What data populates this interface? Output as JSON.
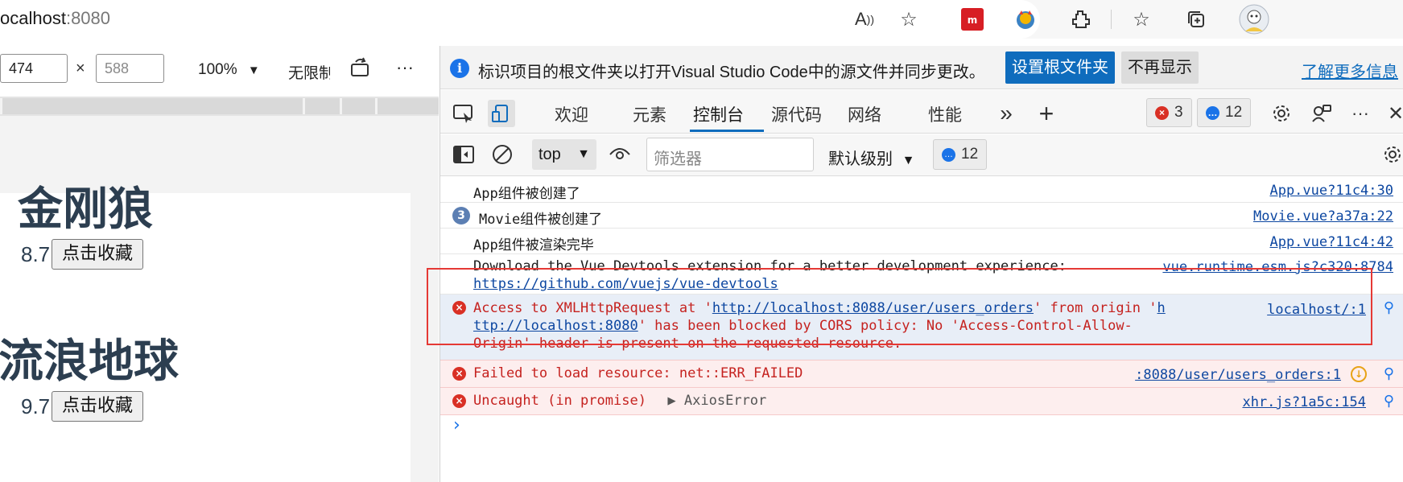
{
  "browser": {
    "url_host": "ocalhost",
    "url_port": ":8080",
    "icons": [
      "read-aloud-icon",
      "add-favorite-icon",
      "mendeley-icon",
      "extension-cat-icon",
      "extensions-icon",
      "favorites-icon",
      "collections-icon",
      "profile-avatar"
    ]
  },
  "device": {
    "width": "474",
    "height_placeholder": "588",
    "times": "×",
    "zoom": "100%",
    "throttle": "无限制",
    "more": "···"
  },
  "page": {
    "movies": [
      {
        "title": "金刚狼",
        "score": "8.7",
        "button": "点击收藏"
      },
      {
        "title": "流浪地球",
        "score": "9.7",
        "button": "点击收藏"
      }
    ]
  },
  "devtools": {
    "info": {
      "text": "标识项目的根文件夹以打开Visual Studio Code中的源文件并同步更改。",
      "primary_button": "设置根文件夹",
      "secondary_button": "不再显示",
      "learn_more": "了解更多信息"
    },
    "tabs": [
      "欢迎",
      "元素",
      "控制台",
      "源代码",
      "网络",
      "性能"
    ],
    "active_tab": "控制台",
    "error_count": "3",
    "message_count": "12",
    "console_bar": {
      "context": "top",
      "filter_placeholder": "筛选器",
      "level": "默认级别",
      "messages": "12"
    },
    "messages": [
      {
        "text": "App组件被创建了",
        "source": "App.vue?11c4:30"
      },
      {
        "count": "3",
        "text": "Movie组件被创建了",
        "source": "Movie.vue?a37a:22"
      },
      {
        "text": "App组件被渲染完毕",
        "source": "App.vue?11c4:42"
      },
      {
        "text": "Download the Vue Devtools extension for a better development experience: ",
        "source": "vue.runtime.esm.js?c320:8784",
        "link": "https://github.com/vuejs/vue-devtools"
      },
      {
        "pre": "Access to XMLHttpRequest at '",
        "url1": "http://localhost:8088/user/users_orders",
        "mid": "' from origin '",
        "url2a": "h",
        "url2b": "ttp://localhost:8080",
        "post1": "' has been blocked by CORS policy: No 'Access-Control-Allow-",
        "post2": "Origin' header is present on the requested resource.",
        "source": "localhost/:1"
      },
      {
        "text": "Failed to load resource: net::ERR_FAILED",
        "source": ":8088/user/users_orders:1"
      },
      {
        "text": "Uncaught (in promise)",
        "object": "AxiosError",
        "source": "xhr.js?1a5c:154"
      }
    ],
    "prompt": "›"
  },
  "colors": {
    "accent": "#0f6cbd",
    "error": "#d93025",
    "error_bg": "#fdeeee",
    "highlight": "#e53935",
    "heading": "#2c3e50"
  }
}
